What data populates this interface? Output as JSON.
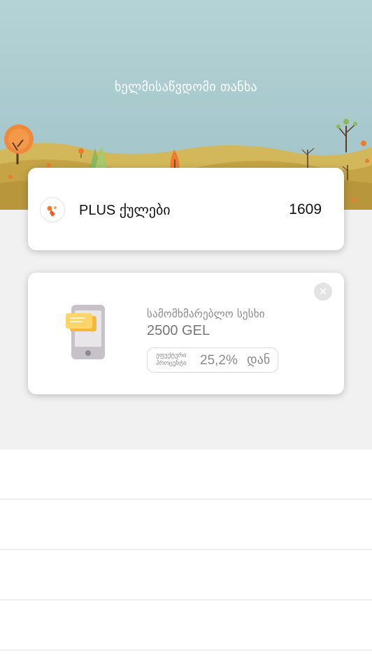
{
  "header": {
    "title": "ხელმისაწვდომი თანხა"
  },
  "points_card": {
    "label": "PLUS ქულები",
    "value": "1609",
    "icon": "plus-logo-icon"
  },
  "loan_card": {
    "type": "სამომხმარებლო სესხი",
    "amount": "2500 GEL",
    "rate_label": "ეფექტური პროცენტი",
    "rate_value": "25,2%",
    "rate_suffix": "დან",
    "icon": "phone-chat-icon",
    "close_icon": "close-icon"
  },
  "colors": {
    "sky": "#a9cbcf",
    "hills": "#c8ad4e",
    "accent_orange": "#ef6a1f"
  }
}
